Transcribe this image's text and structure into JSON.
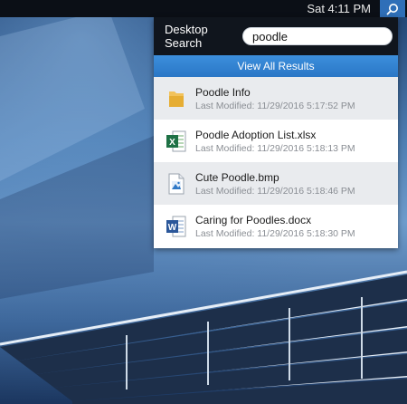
{
  "menubar": {
    "clock": "Sat 4:11 PM",
    "search_icon": "search-icon"
  },
  "search_panel": {
    "title": "Desktop Search",
    "query": "poodle",
    "view_all_label": "View All Results",
    "results": [
      {
        "name": "Poodle Info",
        "meta": "Last Modified: 11/29/2016 5:17:52 PM",
        "icon": "folder-icon"
      },
      {
        "name": "Poodle Adoption List.xlsx",
        "meta": "Last Modified: 11/29/2016 5:18:13 PM",
        "icon": "excel-file-icon"
      },
      {
        "name": "Cute Poodle.bmp",
        "meta": "Last Modified: 11/29/2016 5:18:46 PM",
        "icon": "image-file-icon"
      },
      {
        "name": "Caring for Poodles.docx",
        "meta": "Last Modified: 11/29/2016 5:18:30 PM",
        "icon": "word-file-icon"
      }
    ]
  },
  "colors": {
    "menubar": "#0b0f16",
    "accent": "#2f6fb8",
    "view_all": "#3284d2",
    "row_alt": "#e9ebee"
  }
}
